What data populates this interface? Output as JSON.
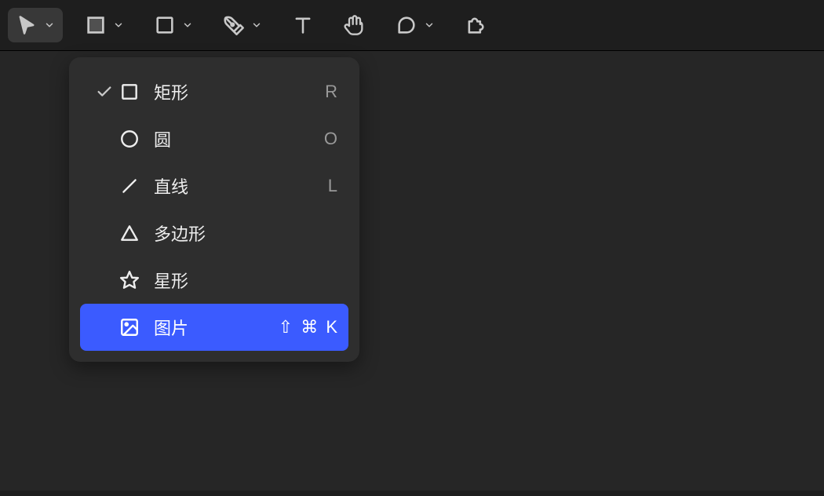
{
  "toolbar": {
    "items": [
      {
        "name": "select-tool",
        "icon": "cursor",
        "hasChevron": true,
        "active": true
      },
      {
        "name": "frame-tool",
        "icon": "frame",
        "hasChevron": true,
        "active": false
      },
      {
        "name": "shape-tool",
        "icon": "rectangle",
        "hasChevron": true,
        "active": false
      },
      {
        "name": "pen-tool",
        "icon": "pen",
        "hasChevron": true,
        "active": false
      },
      {
        "name": "text-tool",
        "icon": "text",
        "hasChevron": false,
        "active": false
      },
      {
        "name": "hand-tool",
        "icon": "hand",
        "hasChevron": false,
        "active": false
      },
      {
        "name": "comment-tool",
        "icon": "comment",
        "hasChevron": true,
        "active": false
      },
      {
        "name": "plugin-tool",
        "icon": "plugin",
        "hasChevron": false,
        "active": false
      }
    ]
  },
  "dropdown": {
    "selectedIndex": 0,
    "highlightIndex": 5,
    "items": [
      {
        "icon": "square",
        "label": "矩形",
        "shortcut": "R"
      },
      {
        "icon": "circle",
        "label": "圆",
        "shortcut": "O"
      },
      {
        "icon": "line",
        "label": "直线",
        "shortcut": "L"
      },
      {
        "icon": "triangle",
        "label": "多边形",
        "shortcut": ""
      },
      {
        "icon": "star",
        "label": "星形",
        "shortcut": ""
      },
      {
        "icon": "image",
        "label": "图片",
        "shortcut": "⇧ ⌘ K"
      }
    ]
  }
}
